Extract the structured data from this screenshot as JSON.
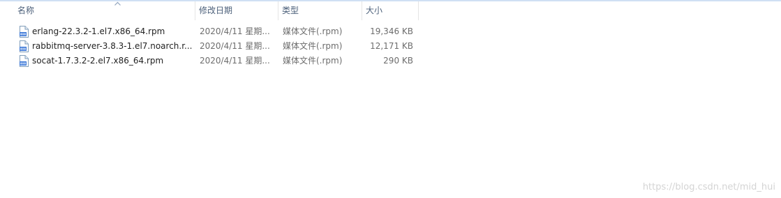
{
  "columns": {
    "name": "名称",
    "modified": "修改日期",
    "type": "类型",
    "size": "大小"
  },
  "sort": {
    "column": "name",
    "icon": "sort-up-chevron-icon"
  },
  "files": [
    {
      "name": "erlang-22.3.2-1.el7.x86_64.rpm",
      "modified": "2020/4/11 星期...",
      "type": "媒体文件(.rpm)",
      "size": "19,346 KB",
      "icon": "rpm-file-icon"
    },
    {
      "name": "rabbitmq-server-3.8.3-1.el7.noarch.r...",
      "modified": "2020/4/11 星期...",
      "type": "媒体文件(.rpm)",
      "size": "12,171 KB",
      "icon": "rpm-file-icon"
    },
    {
      "name": "socat-1.7.3.2-2.el7.x86_64.rpm",
      "modified": "2020/4/11 星期...",
      "type": "媒体文件(.rpm)",
      "size": "290 KB",
      "icon": "rpm-file-icon"
    }
  ],
  "watermark": "https://blog.csdn.net/mid_hui",
  "colors": {
    "header_text": "#4c607a",
    "row_text": "#222222",
    "secondary_text": "#6d6d6d",
    "icon_blue": "#3c78d8"
  }
}
